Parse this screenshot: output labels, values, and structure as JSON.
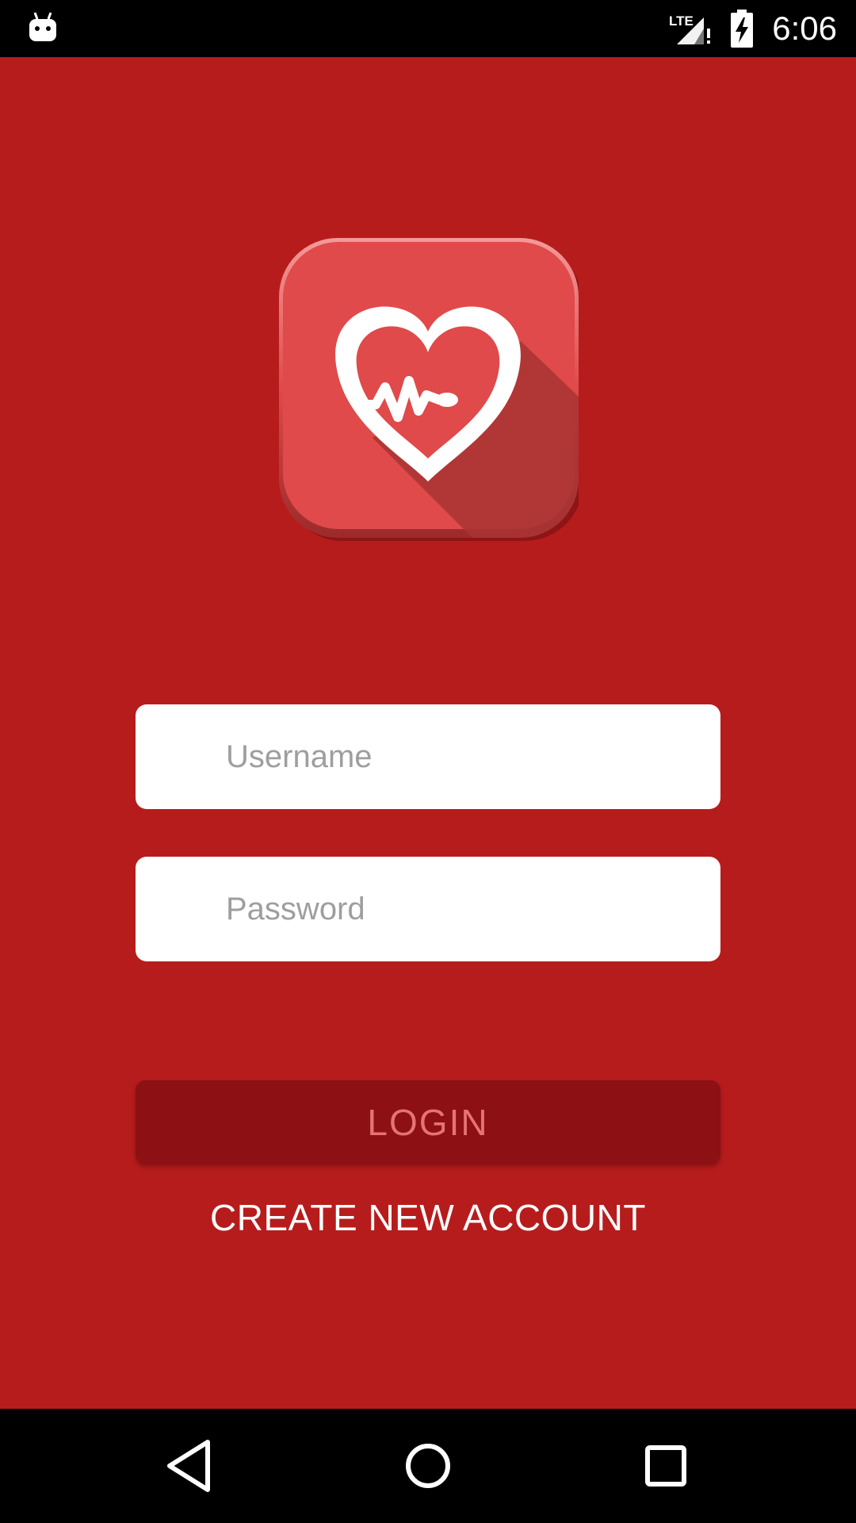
{
  "status_bar": {
    "time": "6:06",
    "network_label": "LTE",
    "icons": [
      "android-notification-icon",
      "lte-signal-icon",
      "battery-charging-icon"
    ]
  },
  "logo": {
    "icon": "heart-pulse-icon",
    "colors": {
      "tile": "#e04a4a",
      "heart": "#ffffff",
      "shadow": "#a83434"
    }
  },
  "form": {
    "username_placeholder": "Username",
    "password_placeholder": "Password",
    "login_label": "LOGIN",
    "create_account_label": "CREATE NEW ACCOUNT"
  },
  "nav_bar": {
    "icons": [
      "back-icon",
      "home-icon",
      "recents-icon"
    ]
  },
  "colors": {
    "background": "#b71c1c",
    "login_button": "#8c1014",
    "login_text": "#e57373",
    "bars": "#000000"
  }
}
